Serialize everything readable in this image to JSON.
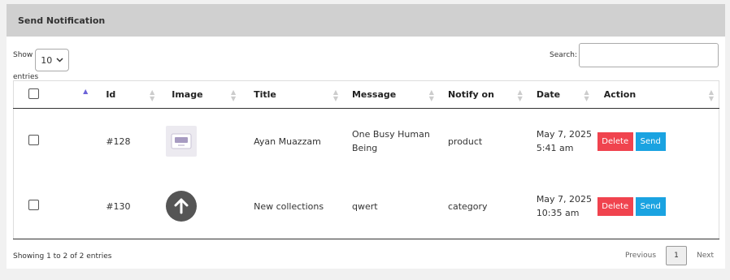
{
  "panel": {
    "title": "Send Notification"
  },
  "length": {
    "show_label": "Show",
    "value": "10",
    "entries_label": "entries"
  },
  "search": {
    "label": "Search:",
    "value": ""
  },
  "columns": [
    "Id",
    "Image",
    "Title",
    "Message",
    "Notify on",
    "Date",
    "Action"
  ],
  "rows": [
    {
      "id": "#128",
      "image": "product-thumbnail",
      "title": "Ayan Muazzam",
      "message": "One Busy Human Being",
      "notify_on": "product",
      "date": "May 7, 2025",
      "time": "5:41 am"
    },
    {
      "id": "#130",
      "image": "arrow-up-icon",
      "title": "New collections",
      "message": "qwert",
      "notify_on": "category",
      "date": "May 7, 2025",
      "time": "10:35 am"
    }
  ],
  "actions": {
    "delete": "Delete",
    "send": "Send"
  },
  "footer": {
    "info": "Showing 1 to 2 of 2 entries"
  },
  "pagination": {
    "previous": "Previous",
    "current": "1",
    "next": "Next"
  },
  "colors": {
    "delete": "#f0434e",
    "send": "#1aa3e1",
    "header_bg": "#d0d0d0",
    "sort_active": "#6c63d8"
  }
}
